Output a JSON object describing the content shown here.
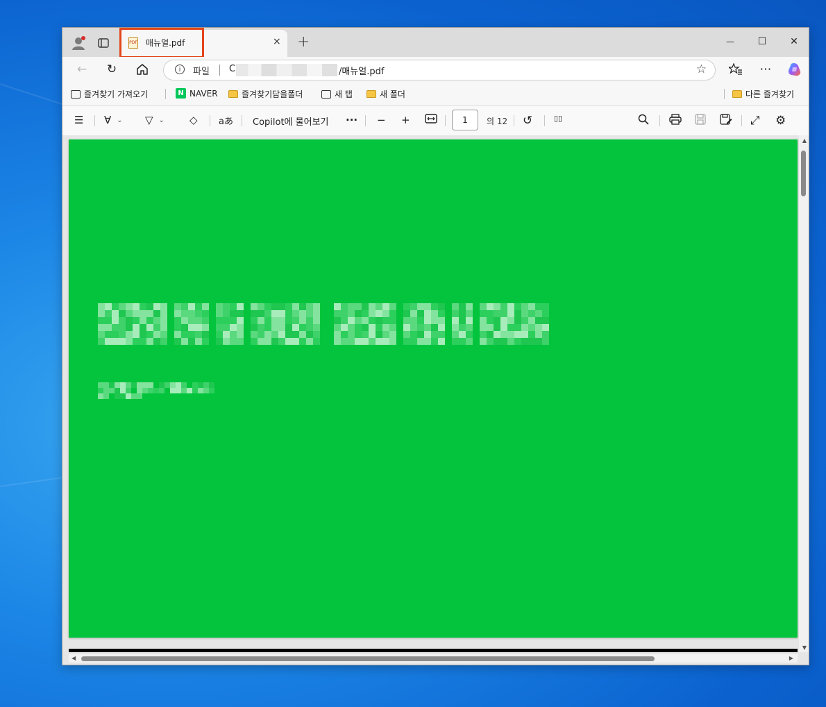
{
  "browser": {
    "tab": {
      "title": "매뉴얼.pdf",
      "icon": "pdf-file-icon",
      "close": "×"
    },
    "new_tab": "+",
    "window_controls": {
      "minimize": "—",
      "maximize": "☐",
      "close": "✕"
    },
    "address": {
      "scheme_label": "파일",
      "url_prefix": "C:",
      "url_path": "/매뉴얼.pdf"
    },
    "icons": {
      "back": "←",
      "refresh": "↻",
      "home": "⌂",
      "star": "☆",
      "favorites": "☆≡",
      "more": "⋯",
      "copilot": "copilot-icon"
    }
  },
  "favorites_bar": {
    "import": "즐겨찾기 가져오기",
    "naver": "NAVER",
    "naver_badge": "N",
    "folder1": "즐겨찾기담을폴더",
    "new_tab": "새 탭",
    "new_folder": "새 폴더",
    "other": "다른 즐겨찾기"
  },
  "pdf_toolbar": {
    "contents": "☰",
    "highlight": "∀",
    "draw": "▽",
    "chevron": "⌄",
    "erase": "◇",
    "read_aloud": "aあ",
    "copilot_ask": "Copilot에 물어보기",
    "more": "···",
    "zoom_out": "−",
    "zoom_in": "+",
    "fit": "↔",
    "page_current": "1",
    "page_total": "의 12",
    "rotate": "↺",
    "page_view": "▯▯",
    "search": "⌕",
    "print": "⎙",
    "save": "💾",
    "save_as": "✎",
    "fullscreen": "⤢",
    "settings": "⚙"
  },
  "pdf": {
    "page_color": "#03c43c"
  },
  "colors": {
    "tab_highlight": "#e3451b",
    "naver_green": "#03c75a"
  }
}
